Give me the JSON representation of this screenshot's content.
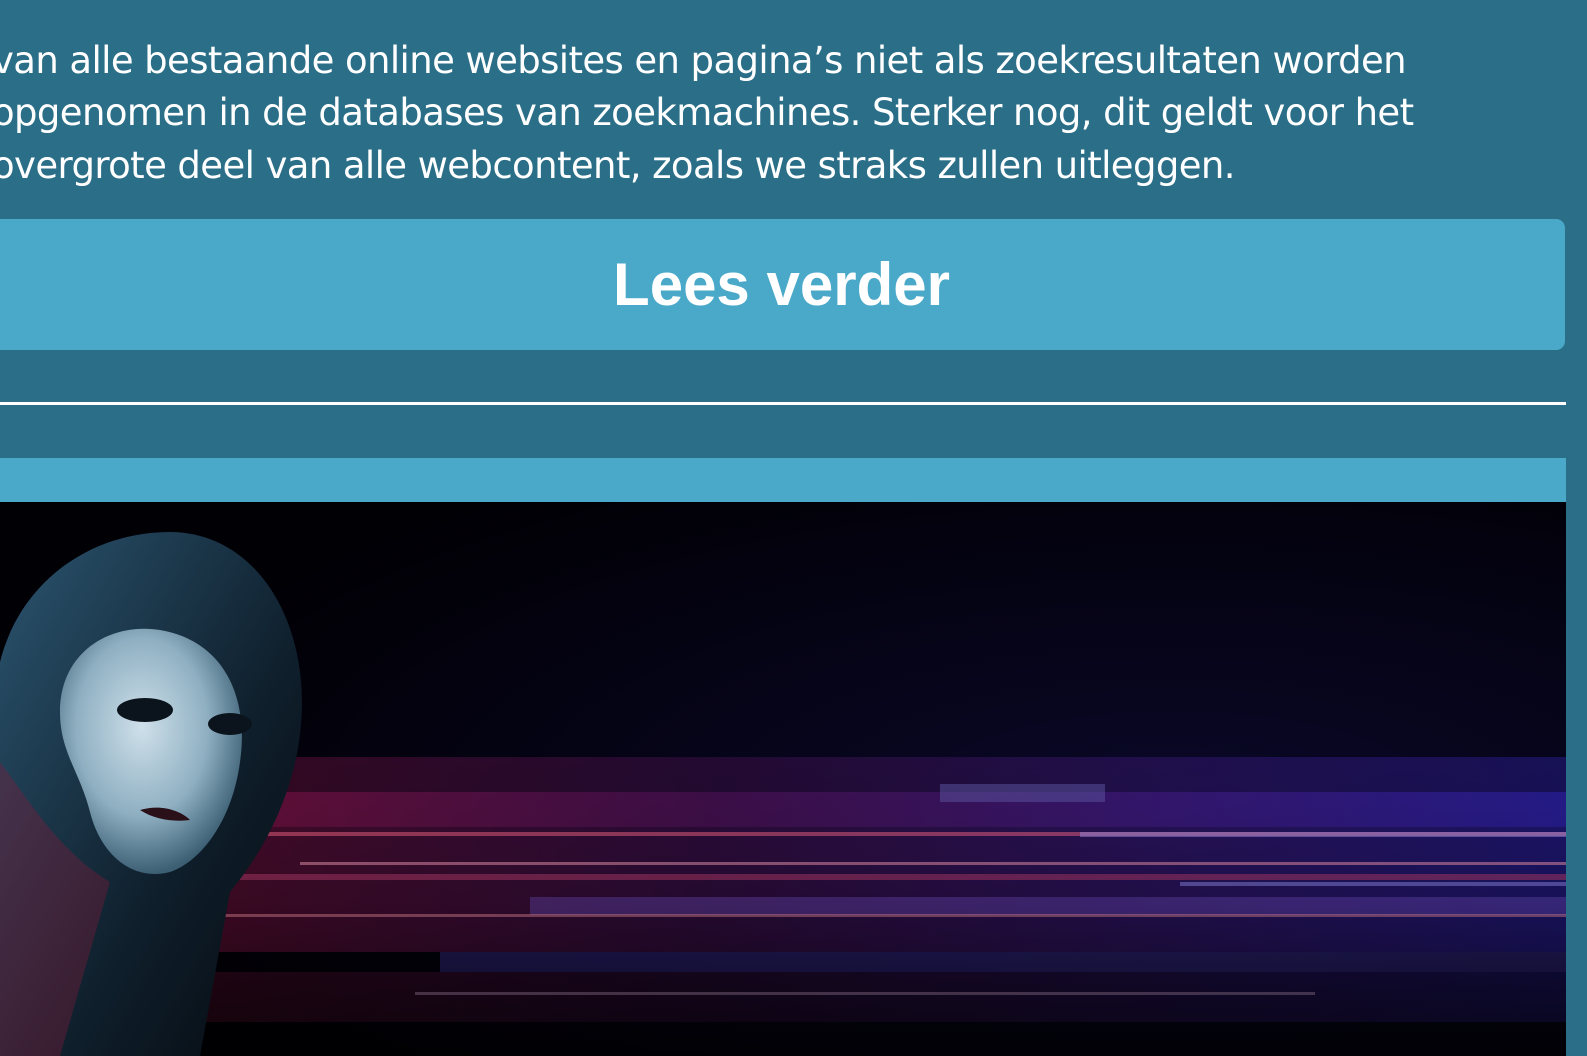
{
  "article": {
    "intro_lines": [
      "van alle bestaande online websites en pagina’s niet als zoekresultaten worden",
      "opgenomen in de databases van zoekmachines. Sterker nog, dit geldt voor het",
      "overgrote deel van alle webcontent, zoals we straks zullen uitleggen."
    ],
    "read_more_label": "Lees verder"
  },
  "hero": {
    "image": "hooded-masked-hacker-dark-streaks",
    "colors": {
      "background": "#020108",
      "red_streak": "#c0184a",
      "blue_streak": "#3a2bd8"
    }
  },
  "colors": {
    "page_background": "#2a6e88",
    "accent": "#4aa9c9",
    "text": "#ffffff"
  }
}
